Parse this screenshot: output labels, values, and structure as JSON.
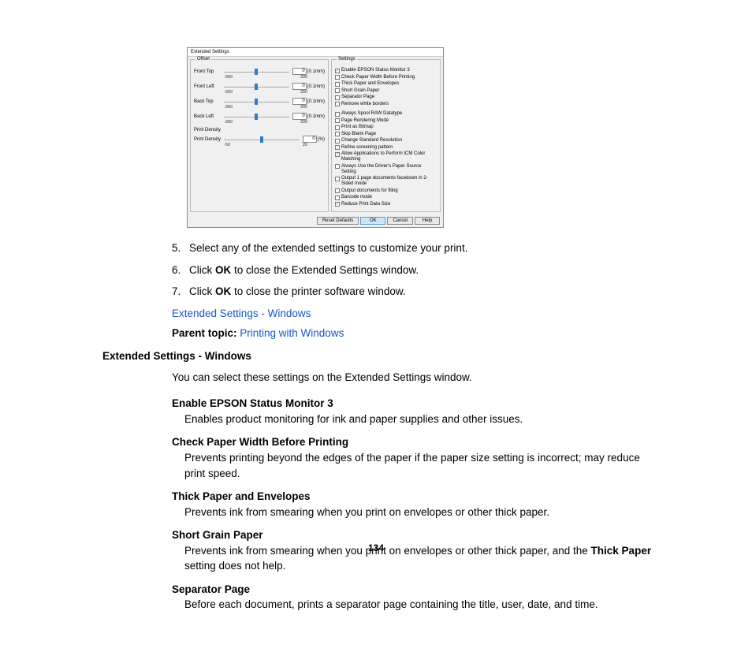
{
  "dialog": {
    "title": "Extended Settings",
    "offset_label": "Offset",
    "sliders": [
      {
        "label": "Front Top",
        "value": "0",
        "unit": "(0.1mm)",
        "min": "-300",
        "max": "300"
      },
      {
        "label": "Front Left",
        "value": "0",
        "unit": "(0.1mm)",
        "min": "-300",
        "max": "300"
      },
      {
        "label": "Back Top",
        "value": "0",
        "unit": "(0.1mm)",
        "min": "-300",
        "max": "300"
      },
      {
        "label": "Back Left",
        "value": "0",
        "unit": "(0.1mm)",
        "min": "-300",
        "max": "300"
      }
    ],
    "print_density_group": "Print Density",
    "pd_slider": {
      "label": "Print Density",
      "value": "0",
      "unit": "(%)",
      "min": "-50",
      "max": "20"
    },
    "settings_label": "Settings",
    "checks": [
      {
        "label": "Enable EPSON Status Monitor 3",
        "checked": true
      },
      {
        "label": "Check Paper Width Before Printing",
        "checked": false
      },
      {
        "label": "Thick Paper and Envelopes",
        "checked": false
      },
      {
        "label": "Short Grain Paper",
        "checked": false
      },
      {
        "label": "Separator Page",
        "checked": false
      },
      {
        "label": "Remove white borders",
        "checked": false
      }
    ],
    "checks2": [
      {
        "label": "Always Spool RAW Datatype",
        "checked": false
      },
      {
        "label": "Page Rendering Mode",
        "checked": false
      },
      {
        "label": "Print as Bitmap",
        "checked": false
      },
      {
        "label": "Skip Blank Page",
        "checked": false
      },
      {
        "label": "Change Standard Resolution",
        "checked": false
      },
      {
        "label": "Refine screening pattern",
        "checked": false
      },
      {
        "label": "Allow Applications to Perform ICM Color Matching",
        "checked": true
      },
      {
        "label": "Always Use the Driver's Paper Source Setting",
        "checked": false
      },
      {
        "label": "Output 1 page documents facedown in 2-Sided mode",
        "checked": false
      },
      {
        "label": "Output documents for filing",
        "checked": false
      },
      {
        "label": "Barcode mode",
        "checked": false
      },
      {
        "label": "Reduce Print Data Size",
        "checked": true
      }
    ],
    "buttons": {
      "reset": "Reset Defaults",
      "ok": "OK",
      "cancel": "Cancel",
      "help": "Help"
    }
  },
  "steps": [
    {
      "num": "5.",
      "text_before": "Select any of the extended settings to customize your print.",
      "bold": "",
      "text_after": ""
    },
    {
      "num": "6.",
      "text_before": "Click ",
      "bold": "OK",
      "text_after": " to close the Extended Settings window."
    },
    {
      "num": "7.",
      "text_before": "Click ",
      "bold": "OK",
      "text_after": " to close the printer software window."
    }
  ],
  "link1": "Extended Settings - Windows",
  "parent_label": "Parent topic: ",
  "parent_link": "Printing with Windows",
  "heading": "Extended Settings - Windows",
  "intro": "You can select these settings on the Extended Settings window.",
  "defs": [
    {
      "term": "Enable EPSON Status Monitor 3",
      "desc": "Enables product monitoring for ink and paper supplies and other issues."
    },
    {
      "term": "Check Paper Width Before Printing",
      "desc": "Prevents printing beyond the edges of the paper if the paper size setting is incorrect; may reduce print speed."
    },
    {
      "term": "Thick Paper and Envelopes",
      "desc": "Prevents ink from smearing when you print on envelopes or other thick paper."
    },
    {
      "term": "Short Grain Paper",
      "desc_before": "Prevents ink from smearing when you print on envelopes or other thick paper, and the ",
      "desc_bold": "Thick Paper",
      "desc_after": " setting does not help."
    },
    {
      "term": "Separator Page",
      "desc": "Before each document, prints a separator page containing the title, user, date, and time."
    }
  ],
  "page_number": "134"
}
